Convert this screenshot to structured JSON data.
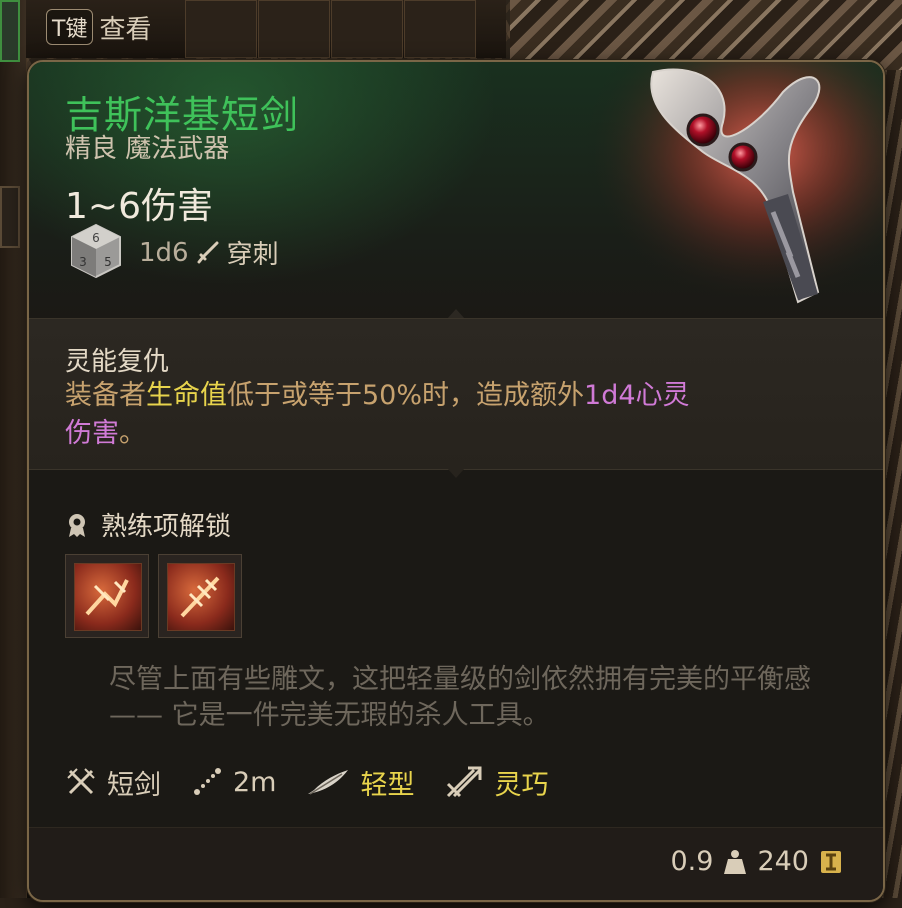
{
  "hotkey": {
    "key": "T键",
    "action": "查看"
  },
  "item": {
    "name": "吉斯洋基短剑",
    "rarity": "精良 魔法武器",
    "damage_range": "1~6伤害",
    "damage_dice": "1d6",
    "damage_type": "穿刺",
    "colors": {
      "name": "#3fc25a",
      "highlight": "#e8d44c",
      "psychic": "#d07ad6",
      "description": "#c7a26e"
    }
  },
  "ability": {
    "title": "灵能复仇",
    "desc_part1": "装备者",
    "desc_highlight": "生命值",
    "desc_part2": "低于或等于50%时，造成额外",
    "desc_damage": "1d4心灵",
    "desc_damage2": "伤害",
    "desc_end": "。"
  },
  "proficiency": {
    "title": "熟练项解锁",
    "icons": [
      "weapon-action-icon-1",
      "weapon-action-icon-2"
    ]
  },
  "flavor_text": "尽管上面有些雕文，这把轻量级的剑依然拥有完美的平衡感 —— 它是一件完美无瑕的杀人工具。",
  "properties": [
    {
      "icon": "crossed-swords-icon",
      "label": "短剑"
    },
    {
      "icon": "range-icon",
      "label": "2m"
    },
    {
      "icon": "feather-icon",
      "label": "轻型"
    },
    {
      "icon": "finesse-icon",
      "label": "灵巧"
    }
  ],
  "footer": {
    "weight": "0.9",
    "weight_icon": "weight-icon",
    "value": "240",
    "value_icon": "gold-icon"
  }
}
